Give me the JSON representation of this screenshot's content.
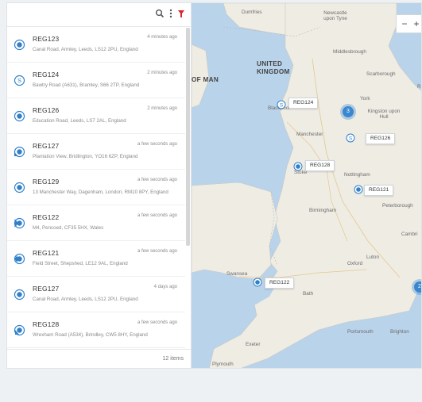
{
  "toolbar": {
    "search_icon": "search-icon",
    "more_icon": "kebab-icon",
    "filter_icon": "filter-icon",
    "filter_color": "#d9262c"
  },
  "vehicles": [
    {
      "reg": "REG123",
      "ago": "4 minutes ago",
      "address": "Canal Road, Armley, Leeds, LS12 2PU, England",
      "icon": "stopped"
    },
    {
      "reg": "REG124",
      "ago": "2 minutes ago",
      "address": "Bawtry Road (A631), Bramley, S66 2TP, England",
      "icon": "speed"
    },
    {
      "reg": "REG126",
      "ago": "2 minutes ago",
      "address": "Education Road, Leeds, LS7 2AL, England",
      "icon": "stopped"
    },
    {
      "reg": "REG127",
      "ago": "a few seconds ago",
      "address": "Plantation View, Bridlington, YO16 6ZP, England",
      "icon": "moving-sw"
    },
    {
      "reg": "REG129",
      "ago": "a few seconds ago",
      "address": "13 Manchester Way, Dagenham, London, RM10 8PY, England",
      "icon": "stopped"
    },
    {
      "reg": "REG122",
      "ago": "a few seconds ago",
      "address": "M4, Pencoed, CF35 5HX, Wales",
      "icon": "moving-e"
    },
    {
      "reg": "REG121",
      "ago": "a few seconds ago",
      "address": "Field Street, Shepshed, LE12 9AL, England",
      "icon": "moving-w"
    },
    {
      "reg": "REG127",
      "ago": "4 days ago",
      "address": "Canal Road, Armley, Leeds, LS12 2PU, England",
      "icon": "stopped"
    },
    {
      "reg": "REG128",
      "ago": "a few seconds ago",
      "address": "Wrexham Road (A534), Brindley, CW5 8HY, England",
      "icon": "moving-ne"
    }
  ],
  "footer": {
    "count": "12 items"
  },
  "map": {
    "places": {
      "dumfries": "Dumfries",
      "newcastle": "Newcastle upon Tyne",
      "middlesbrough": "Middlesbrough",
      "scarborough": "Scarborough",
      "york": "York",
      "kingston": "Kingston upon Hull",
      "blackpool": "Blackpool",
      "manchester": "Manchester",
      "stoke": "Stoke",
      "nottingham": "Nottingham",
      "birmingham": "Birmingham",
      "peterborough": "Peterborough",
      "cambridge": "Cambri",
      "luton": "Luton",
      "oxford": "Oxford",
      "swansea": "Swansea",
      "bath": "Bath",
      "portsmouth": "Portsmouth",
      "brighton": "Brighton",
      "exeter": "Exeter",
      "plymouth": "Plymouth",
      "edge_r": "Rk"
    },
    "countries": {
      "uk": "UNITED KINGDOM",
      "isle_of_man": "OF MAN"
    },
    "markers": {
      "reg124": "REG124",
      "reg126": "REG126",
      "reg128": "REG128",
      "reg121": "REG121",
      "reg122": "REG122"
    },
    "clusters": {
      "north": "3",
      "south": "2"
    },
    "zoom": {
      "out": "−",
      "in": "+"
    },
    "colors": {
      "sea": "#b9d3ea",
      "land": "#efece4",
      "marker": "#2f7fc9",
      "cluster": "#3a87d1"
    }
  }
}
